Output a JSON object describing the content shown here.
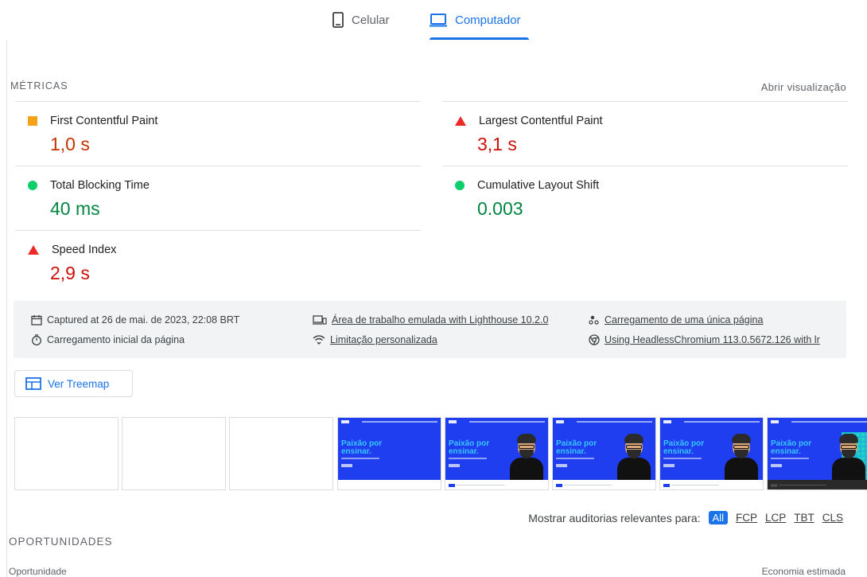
{
  "tabs": {
    "mobile": "Celular",
    "desktop": "Computador"
  },
  "metrics": {
    "label": "MÉTRICAS",
    "toggle": "Abrir visualização",
    "fcp": {
      "name": "First Contentful Paint",
      "value": "1,0 s",
      "status": "average",
      "color": "#c33300"
    },
    "lcp": {
      "name": "Largest Contentful Paint",
      "value": "3,1 s",
      "status": "fail",
      "color": "#cc0f06"
    },
    "tbt": {
      "name": "Total Blocking Time",
      "value": "40 ms",
      "status": "pass",
      "color": "#018642"
    },
    "cls": {
      "name": "Cumulative Layout Shift",
      "value": "0.003",
      "status": "pass",
      "color": "#018642"
    },
    "si": {
      "name": "Speed Index",
      "value": "2,9 s",
      "status": "fail",
      "color": "#cc0f06"
    }
  },
  "runtime": {
    "captured": "Captured at 26 de mai. de 2023, 22:08 BRT",
    "initial": "Carregamento inicial da página",
    "emulated": "Área de trabalho emulada with Lighthouse 10.2.0",
    "throttling": "Limitação personalizada",
    "single": "Carregamento de uma única página",
    "browser": "Using HeadlessChromium 113.0.5672.126 with lr"
  },
  "treemap": {
    "label": "Ver Treemap"
  },
  "filmstrip": {
    "headline": "Paixão por\nensinar."
  },
  "filter": {
    "label": "Mostrar auditorias relevantes para:",
    "all": "All",
    "fcp": "FCP",
    "lcp": "LCP",
    "tbt": "TBT",
    "cls": "CLS"
  },
  "opportunities": {
    "label": "OPORTUNIDADES",
    "col_left": "Oportunidade",
    "col_right": "Economia estimada"
  }
}
